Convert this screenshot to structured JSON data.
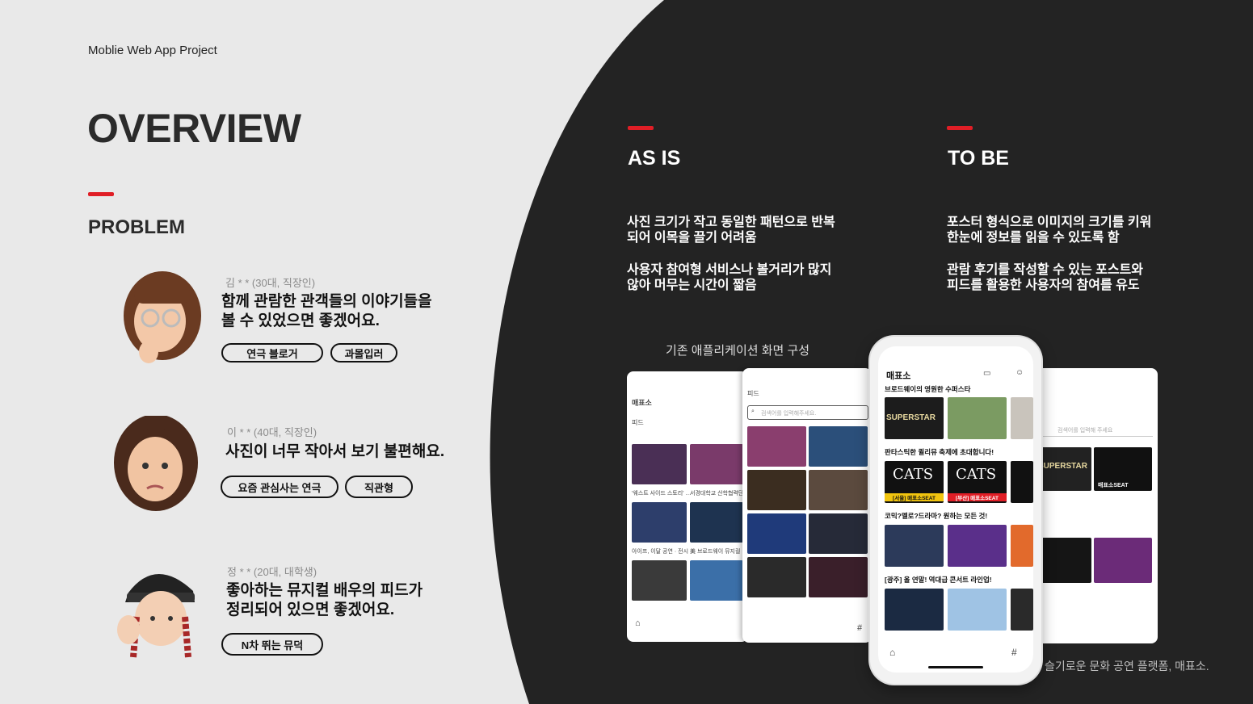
{
  "header": {
    "project": "Moblie Web App Project",
    "title": "OVERVIEW",
    "section": "PROBLEM"
  },
  "personas": [
    {
      "name": "김 * * (30대, 직장인)",
      "quote_line1": "함께 관람한 관객들의 이야기들을",
      "quote_line2": "볼 수 있었으면 좋겠어요.",
      "tags": [
        "연극 블로거",
        "과몰입러"
      ]
    },
    {
      "name": "이 * * (40대, 직장인)",
      "quote_line1": "사진이 너무 작아서 보기 불편해요.",
      "tags": [
        "요즘 관심사는 연극",
        "직관형"
      ]
    },
    {
      "name": "정 * * (20대, 대학생)",
      "quote_line1": "좋아하는 뮤지컬 배우의 피드가",
      "quote_line2": "정리되어 있으면 좋겠어요.",
      "tags": [
        "N차 뛰는 뮤덕"
      ]
    }
  ],
  "as_is": {
    "title": "AS IS",
    "p1_line1": "사진 크기가 작고 동일한 패턴으로 반복",
    "p1_line2": "되어 이목을 끌기 어려움",
    "p2_line1": "사용자 참여형 서비스나 볼거리가 많지",
    "p2_line2": "않아 머무는 시간이 짧음",
    "caption": "기존 애플리케이션 화면 구성"
  },
  "to_be": {
    "title": "TO BE",
    "p1_line1": "포스터 형식으로 이미지의 크기를 키워",
    "p1_line2": "한눈에 정보를 읽을 수 있도록 함",
    "p2_line1": "관람 후기를 작성할 수 있는 포스트와",
    "p2_line2": "피드를 활용한 사용자의 참여를 유도"
  },
  "phone": {
    "logo": "매표소",
    "row1": "브로드웨이의 영원한 수퍼스타",
    "row2": "판타스틱한 퀼리뮤 축제에 초대합니다!",
    "row3": "코믹?멜로?드라마? 원하는 모든 것!",
    "row4": "[광주] 올 연말! 역대급 콘서트 라인업!",
    "poster_superstar": "SUPERSTAR",
    "poster_cats": "CATS",
    "badge_seoul": "[서울] 매표소SEAT",
    "badge_busan": "[부산] 매표소SEAT"
  },
  "screen_old": {
    "logo": "매표소",
    "feed_label": "피드",
    "caption1": "'웨스트 사이드 스토리' …",
    "caption2": "서경대학교 산학협력단 …",
    "caption3": "아이프, 이달 공연 · 전시 …",
    "caption4": "美 브로드웨이 뮤지컬 …"
  },
  "screen_feed": {
    "title": "피드",
    "search_placeholder": "검색어를 입력해주세요."
  },
  "screen_right": {
    "poster_superstar": "SUPERSTAR",
    "seat": "매표소SEAT",
    "search_placeholder": "검색어를 입력해 주세요"
  },
  "footer": {
    "text": "슬기로운 문화 공연 플랫폼, 매표소."
  },
  "colors": {
    "accent": "#e01e26",
    "dark_bg": "#232323",
    "light_bg": "#e9e9e9"
  },
  "icons": [
    "home-icon",
    "ticket-icon",
    "user-icon",
    "search-icon",
    "hashtag-icon"
  ]
}
